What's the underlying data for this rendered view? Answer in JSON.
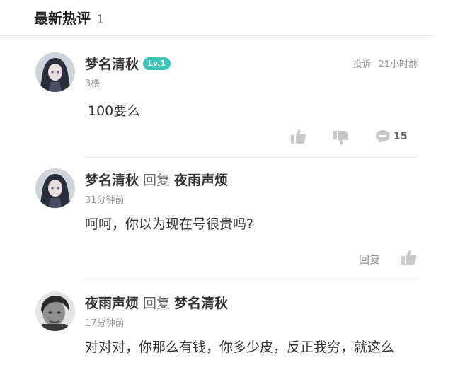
{
  "section": {
    "title": "最新热评",
    "count": "1"
  },
  "main_comment": {
    "username": "梦名清秋",
    "level": "Lv.1",
    "floor": "3楼",
    "report": "投诉",
    "time": "21小时前",
    "content": "100要么",
    "comment_count": "15"
  },
  "replies": [
    {
      "username": "梦名清秋",
      "reply_word": "回复",
      "reply_to": "夜雨声烦",
      "time": "31分钟前",
      "content": "呵呵，你以为现在号很贵吗?",
      "reply_label": "回复"
    },
    {
      "username": "夜雨声烦",
      "reply_word": "回复",
      "reply_to": "梦名清秋",
      "time": "17分钟前",
      "content": "对对对，你那么有钱，你多少皮，反正我穷，就这么"
    }
  ],
  "icons": {
    "like": "thumbs-up-icon",
    "dislike": "thumbs-down-icon",
    "comment": "comment-bubble-icon"
  },
  "colors": {
    "badge": "#3fc6b8",
    "icon": "#c8c8c8"
  }
}
